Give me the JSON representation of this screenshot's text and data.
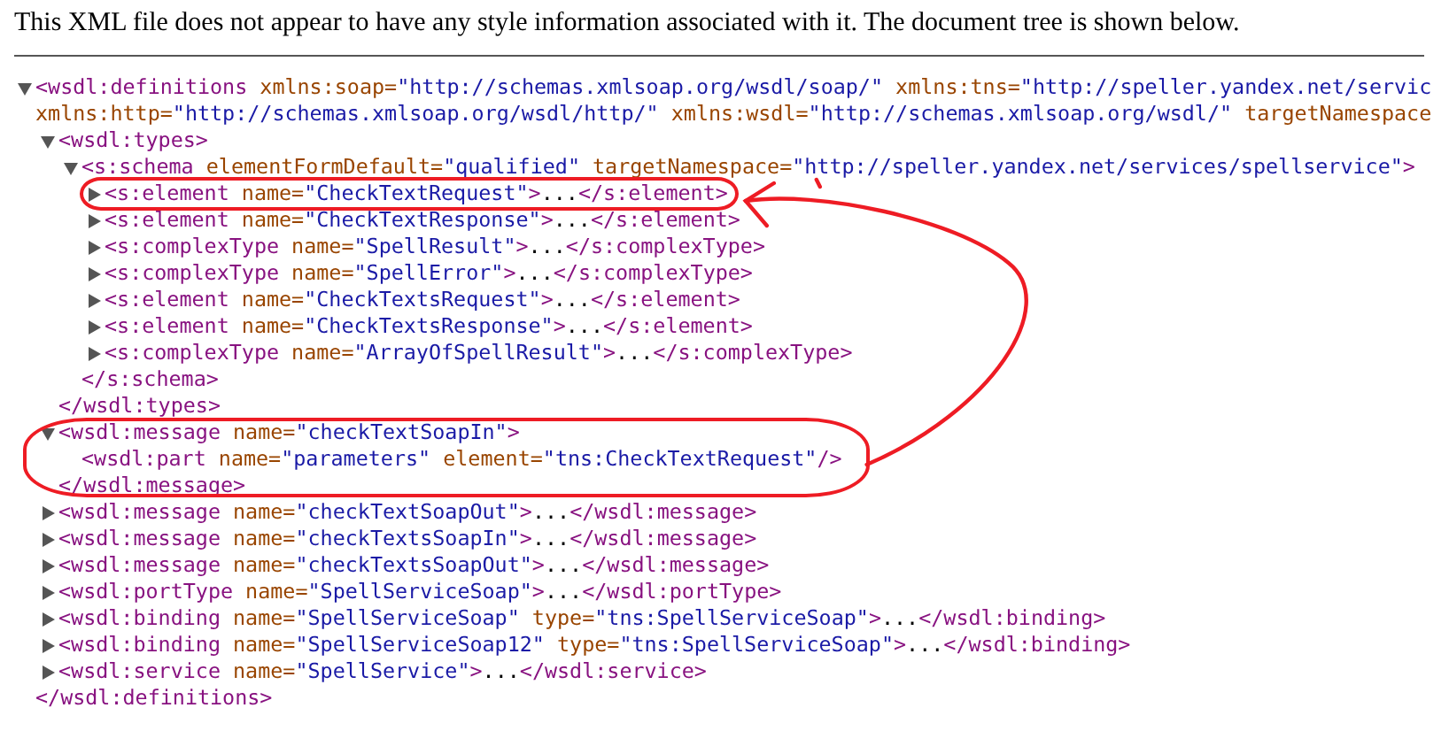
{
  "header": {
    "text": "This XML file does not appear to have any style information associated with it. The document tree is shown below."
  },
  "tree": [
    {
      "kind": "element",
      "expanded": true,
      "highlighted": false,
      "tokens": [
        {
          "kind": "tag",
          "text": "<wsdl:definitions"
        },
        {
          "kind": "attr",
          "text": " xmlns:soap="
        },
        {
          "kind": "value",
          "text": "\"http://schemas.xmlsoap.org/wsdl/soap/\""
        },
        {
          "kind": "attr",
          "text": " xmlns:tns="
        },
        {
          "kind": "value",
          "text": "\"http://speller.yandex.net/servic"
        },
        {
          "kind": "break"
        },
        {
          "kind": "attr",
          "text": "xmlns:http="
        },
        {
          "kind": "value",
          "text": "\"http://schemas.xmlsoap.org/wsdl/http/\""
        },
        {
          "kind": "attr",
          "text": " xmlns:wsdl="
        },
        {
          "kind": "value",
          "text": "\"http://schemas.xmlsoap.org/wsdl/\""
        },
        {
          "kind": "attr",
          "text": " targetNamespace"
        }
      ],
      "children": [
        {
          "kind": "element",
          "expanded": true,
          "highlighted": false,
          "tokens": [
            {
              "kind": "tag",
              "text": "<wsdl:types>"
            }
          ],
          "children": [
            {
              "kind": "element",
              "expanded": true,
              "highlighted": false,
              "tokens": [
                {
                  "kind": "tag",
                  "text": "<s:schema"
                },
                {
                  "kind": "attr",
                  "text": " elementFormDefault="
                },
                {
                  "kind": "value",
                  "text": "\"qualified\""
                },
                {
                  "kind": "attr",
                  "text": " targetNamespace="
                },
                {
                  "kind": "value",
                  "text": "\"http://speller.yandex.net/services/spellservice\""
                },
                {
                  "kind": "tag",
                  "text": ">"
                }
              ],
              "children": [
                {
                  "kind": "element",
                  "expanded": false,
                  "highlighted": true,
                  "tokens": [
                    {
                      "kind": "tag",
                      "text": "<s:element"
                    },
                    {
                      "kind": "attr",
                      "text": " name="
                    },
                    {
                      "kind": "value",
                      "text": "\"CheckTextRequest\""
                    },
                    {
                      "kind": "tag",
                      "text": ">"
                    },
                    {
                      "kind": "text",
                      "text": "..."
                    },
                    {
                      "kind": "tag",
                      "text": "</s:element>"
                    }
                  ]
                },
                {
                  "kind": "element",
                  "expanded": false,
                  "highlighted": false,
                  "tokens": [
                    {
                      "kind": "tag",
                      "text": "<s:element"
                    },
                    {
                      "kind": "attr",
                      "text": " name="
                    },
                    {
                      "kind": "value",
                      "text": "\"CheckTextResponse\""
                    },
                    {
                      "kind": "tag",
                      "text": ">"
                    },
                    {
                      "kind": "text",
                      "text": "..."
                    },
                    {
                      "kind": "tag",
                      "text": "</s:element>"
                    }
                  ]
                },
                {
                  "kind": "element",
                  "expanded": false,
                  "highlighted": false,
                  "tokens": [
                    {
                      "kind": "tag",
                      "text": "<s:complexType"
                    },
                    {
                      "kind": "attr",
                      "text": " name="
                    },
                    {
                      "kind": "value",
                      "text": "\"SpellResult\""
                    },
                    {
                      "kind": "tag",
                      "text": ">"
                    },
                    {
                      "kind": "text",
                      "text": "..."
                    },
                    {
                      "kind": "tag",
                      "text": "</s:complexType>"
                    }
                  ]
                },
                {
                  "kind": "element",
                  "expanded": false,
                  "highlighted": false,
                  "tokens": [
                    {
                      "kind": "tag",
                      "text": "<s:complexType"
                    },
                    {
                      "kind": "attr",
                      "text": " name="
                    },
                    {
                      "kind": "value",
                      "text": "\"SpellError\""
                    },
                    {
                      "kind": "tag",
                      "text": ">"
                    },
                    {
                      "kind": "text",
                      "text": "..."
                    },
                    {
                      "kind": "tag",
                      "text": "</s:complexType>"
                    }
                  ]
                },
                {
                  "kind": "element",
                  "expanded": false,
                  "highlighted": false,
                  "tokens": [
                    {
                      "kind": "tag",
                      "text": "<s:element"
                    },
                    {
                      "kind": "attr",
                      "text": " name="
                    },
                    {
                      "kind": "value",
                      "text": "\"CheckTextsRequest\""
                    },
                    {
                      "kind": "tag",
                      "text": ">"
                    },
                    {
                      "kind": "text",
                      "text": "..."
                    },
                    {
                      "kind": "tag",
                      "text": "</s:element>"
                    }
                  ]
                },
                {
                  "kind": "element",
                  "expanded": false,
                  "highlighted": false,
                  "tokens": [
                    {
                      "kind": "tag",
                      "text": "<s:element"
                    },
                    {
                      "kind": "attr",
                      "text": " name="
                    },
                    {
                      "kind": "value",
                      "text": "\"CheckTextsResponse\""
                    },
                    {
                      "kind": "tag",
                      "text": ">"
                    },
                    {
                      "kind": "text",
                      "text": "..."
                    },
                    {
                      "kind": "tag",
                      "text": "</s:element>"
                    }
                  ]
                },
                {
                  "kind": "element",
                  "expanded": false,
                  "highlighted": false,
                  "tokens": [
                    {
                      "kind": "tag",
                      "text": "<s:complexType"
                    },
                    {
                      "kind": "attr",
                      "text": " name="
                    },
                    {
                      "kind": "value",
                      "text": "\"ArrayOfSpellResult\""
                    },
                    {
                      "kind": "tag",
                      "text": ">"
                    },
                    {
                      "kind": "text",
                      "text": "..."
                    },
                    {
                      "kind": "tag",
                      "text": "</s:complexType>"
                    }
                  ]
                }
              ],
              "closing": [
                {
                  "kind": "tag",
                  "text": "</s:schema>"
                }
              ]
            }
          ],
          "closing": [
            {
              "kind": "tag",
              "text": "</wsdl:types>"
            }
          ]
        },
        {
          "kind": "element",
          "expanded": true,
          "highlighted": true,
          "tokens": [
            {
              "kind": "tag",
              "text": "<wsdl:message"
            },
            {
              "kind": "attr",
              "text": " name="
            },
            {
              "kind": "value",
              "text": "\"checkTextSoapIn\""
            },
            {
              "kind": "tag",
              "text": ">"
            }
          ],
          "children": [
            {
              "kind": "leaf",
              "highlighted": false,
              "tokens": [
                {
                  "kind": "tag",
                  "text": "<wsdl:part"
                },
                {
                  "kind": "attr",
                  "text": " name="
                },
                {
                  "kind": "value",
                  "text": "\"parameters\""
                },
                {
                  "kind": "attr",
                  "text": " element="
                },
                {
                  "kind": "value",
                  "text": "\"tns:CheckTextRequest\""
                },
                {
                  "kind": "tag",
                  "text": "/>"
                }
              ]
            }
          ],
          "closing": [
            {
              "kind": "tag",
              "text": "</wsdl:message>"
            }
          ]
        },
        {
          "kind": "element",
          "expanded": false,
          "highlighted": false,
          "tokens": [
            {
              "kind": "tag",
              "text": "<wsdl:message"
            },
            {
              "kind": "attr",
              "text": " name="
            },
            {
              "kind": "value",
              "text": "\"checkTextSoapOut\""
            },
            {
              "kind": "tag",
              "text": ">"
            },
            {
              "kind": "text",
              "text": "..."
            },
            {
              "kind": "tag",
              "text": "</wsdl:message>"
            }
          ]
        },
        {
          "kind": "element",
          "expanded": false,
          "highlighted": false,
          "tokens": [
            {
              "kind": "tag",
              "text": "<wsdl:message"
            },
            {
              "kind": "attr",
              "text": " name="
            },
            {
              "kind": "value",
              "text": "\"checkTextsSoapIn\""
            },
            {
              "kind": "tag",
              "text": ">"
            },
            {
              "kind": "text",
              "text": "..."
            },
            {
              "kind": "tag",
              "text": "</wsdl:message>"
            }
          ]
        },
        {
          "kind": "element",
          "expanded": false,
          "highlighted": false,
          "tokens": [
            {
              "kind": "tag",
              "text": "<wsdl:message"
            },
            {
              "kind": "attr",
              "text": " name="
            },
            {
              "kind": "value",
              "text": "\"checkTextsSoapOut\""
            },
            {
              "kind": "tag",
              "text": ">"
            },
            {
              "kind": "text",
              "text": "..."
            },
            {
              "kind": "tag",
              "text": "</wsdl:message>"
            }
          ]
        },
        {
          "kind": "element",
          "expanded": false,
          "highlighted": false,
          "tokens": [
            {
              "kind": "tag",
              "text": "<wsdl:portType"
            },
            {
              "kind": "attr",
              "text": " name="
            },
            {
              "kind": "value",
              "text": "\"SpellServiceSoap\""
            },
            {
              "kind": "tag",
              "text": ">"
            },
            {
              "kind": "text",
              "text": "..."
            },
            {
              "kind": "tag",
              "text": "</wsdl:portType>"
            }
          ]
        },
        {
          "kind": "element",
          "expanded": false,
          "highlighted": false,
          "tokens": [
            {
              "kind": "tag",
              "text": "<wsdl:binding"
            },
            {
              "kind": "attr",
              "text": " name="
            },
            {
              "kind": "value",
              "text": "\"SpellServiceSoap\""
            },
            {
              "kind": "attr",
              "text": " type="
            },
            {
              "kind": "value",
              "text": "\"tns:SpellServiceSoap\""
            },
            {
              "kind": "tag",
              "text": ">"
            },
            {
              "kind": "text",
              "text": "..."
            },
            {
              "kind": "tag",
              "text": "</wsdl:binding>"
            }
          ]
        },
        {
          "kind": "element",
          "expanded": false,
          "highlighted": false,
          "tokens": [
            {
              "kind": "tag",
              "text": "<wsdl:binding"
            },
            {
              "kind": "attr",
              "text": " name="
            },
            {
              "kind": "value",
              "text": "\"SpellServiceSoap12\""
            },
            {
              "kind": "attr",
              "text": " type="
            },
            {
              "kind": "value",
              "text": "\"tns:SpellServiceSoap\""
            },
            {
              "kind": "tag",
              "text": ">"
            },
            {
              "kind": "text",
              "text": "..."
            },
            {
              "kind": "tag",
              "text": "</wsdl:binding>"
            }
          ]
        },
        {
          "kind": "element",
          "expanded": false,
          "highlighted": false,
          "tokens": [
            {
              "kind": "tag",
              "text": "<wsdl:service"
            },
            {
              "kind": "attr",
              "text": " name="
            },
            {
              "kind": "value",
              "text": "\"SpellService\""
            },
            {
              "kind": "tag",
              "text": ">"
            },
            {
              "kind": "text",
              "text": "..."
            },
            {
              "kind": "tag",
              "text": "</wsdl:service>"
            }
          ]
        }
      ],
      "closing": [
        {
          "kind": "tag",
          "text": "</wsdl:definitions>"
        }
      ]
    }
  ],
  "annotation_arrow": {
    "kind": "curved"
  }
}
